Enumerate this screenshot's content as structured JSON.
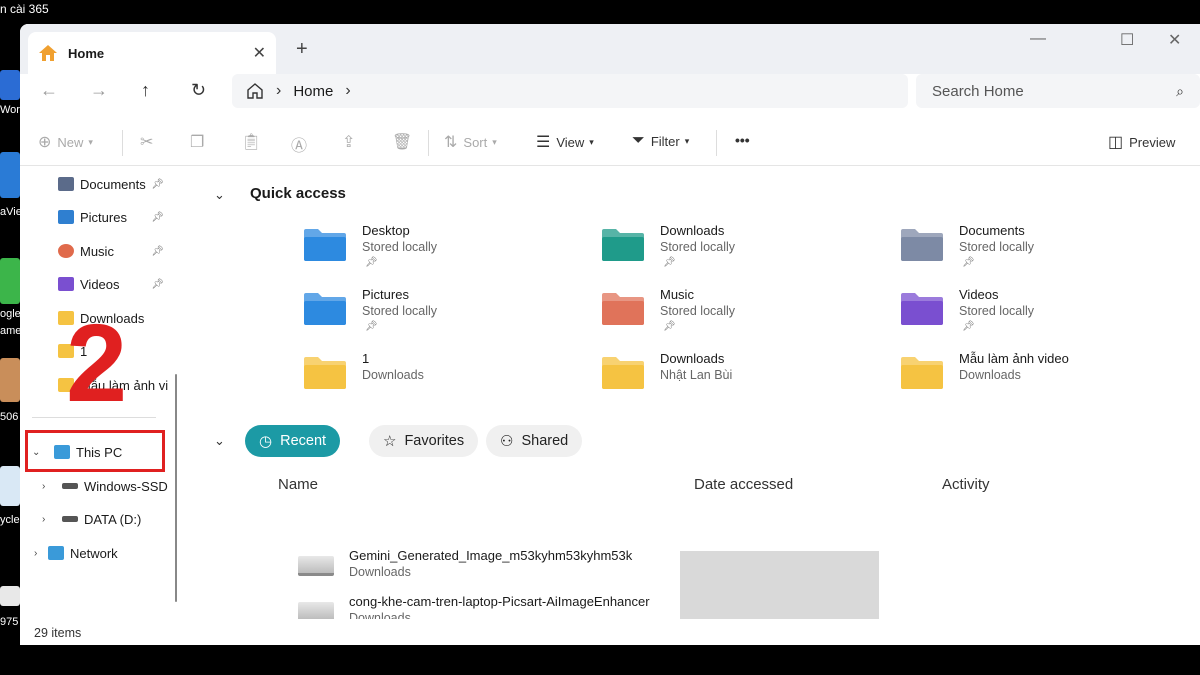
{
  "desktop": {
    "caption": "n cài 365",
    "strip_labels": [
      "Wor",
      "aVie",
      "ogle",
      "ame",
      "506",
      "ycle",
      "975"
    ]
  },
  "tab": {
    "label": "Home"
  },
  "navbar": {
    "breadcrumb": [
      "Home"
    ],
    "search_placeholder": "Search Home"
  },
  "toolbar": {
    "new": "New",
    "sort": "Sort",
    "view": "View",
    "filter": "Filter",
    "more": "•••",
    "preview": "Preview"
  },
  "sidebar": {
    "pinned": [
      {
        "label": "Documents",
        "color": "#5b6b8a"
      },
      {
        "label": "Pictures",
        "color": "#2f7fd0"
      },
      {
        "label": "Music",
        "color": "#e06a4b"
      },
      {
        "label": "Videos",
        "color": "#7a4fd0"
      }
    ],
    "folders": [
      "Downloads",
      "1",
      "Mẫu làm ảnh video"
    ],
    "this_pc": "This PC",
    "drives": [
      "Windows-SSD",
      "DATA (D:)"
    ],
    "network": "Network"
  },
  "annotation": {
    "number": "2",
    "color": "#e02020"
  },
  "quick_access": {
    "title": "Quick access",
    "items": [
      {
        "name": "Desktop",
        "sub": "Stored locally",
        "pinned": true,
        "color": "#2d8ae0"
      },
      {
        "name": "Downloads",
        "sub": "Stored locally",
        "pinned": true,
        "color": "#1f9b8a"
      },
      {
        "name": "Documents",
        "sub": "Stored locally",
        "pinned": true,
        "color": "#7d8aa5"
      },
      {
        "name": "Pictures",
        "sub": "Stored locally",
        "pinned": true,
        "color": "#2d8ae0"
      },
      {
        "name": "Music",
        "sub": "Stored locally",
        "pinned": true,
        "color": "#e0735a"
      },
      {
        "name": "Videos",
        "sub": "Stored locally",
        "pinned": true,
        "color": "#7a4fd0"
      },
      {
        "name": "1",
        "sub": "Downloads",
        "pinned": false,
        "color": "#f5c342"
      },
      {
        "name": "Downloads",
        "sub": "Nhật Lan Bùi",
        "pinned": false,
        "color": "#f5c342"
      },
      {
        "name": "Mẫu làm ảnh video",
        "sub": "Downloads",
        "pinned": false,
        "color": "#f5c342"
      }
    ]
  },
  "filters": {
    "recent": "Recent",
    "favorites": "Favorites",
    "shared": "Shared",
    "accent": "#1c9aa5"
  },
  "columns": {
    "name": "Name",
    "date": "Date accessed",
    "activity": "Activity"
  },
  "files": [
    {
      "name": "Gemini_Generated_Image_m53kyhm53kyhm53k",
      "location": "Downloads"
    },
    {
      "name": "cong-khe-cam-tren-laptop-Picsart-AiImageEnhancer",
      "location": "Downloads"
    }
  ],
  "status": {
    "items": "29 items"
  }
}
